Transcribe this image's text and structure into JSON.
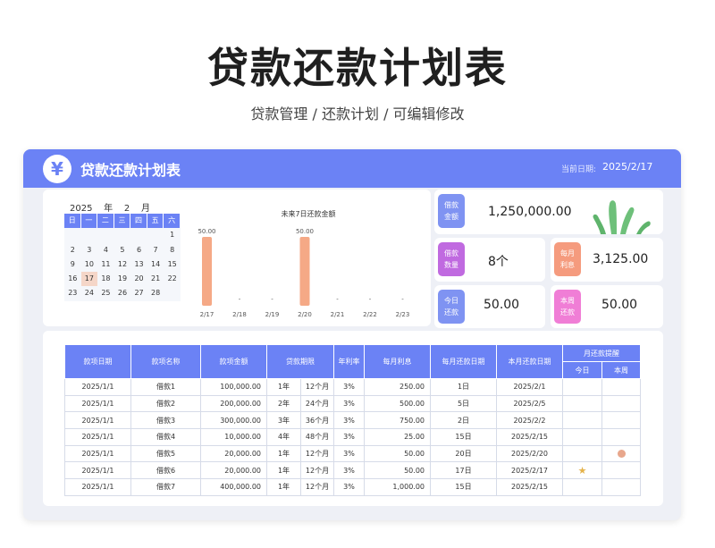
{
  "page": {
    "title": "贷款还款计划表",
    "subtitle": "贷款管理 /  还款计划 /  可编辑修改"
  },
  "header": {
    "app_title": "贷款还款计划表",
    "logo_glyph": "¥",
    "date_label": "当前日期:",
    "date_value": "2025/2/17"
  },
  "calendar": {
    "year": "2025",
    "year_unit": "年",
    "month": "2",
    "month_unit": "月",
    "weekdays": [
      "日",
      "一",
      "二",
      "三",
      "四",
      "五",
      "六"
    ],
    "rows": [
      [
        "",
        "",
        "",
        "",
        "",
        "",
        "1"
      ],
      [
        "2",
        "3",
        "4",
        "5",
        "6",
        "7",
        "8"
      ],
      [
        "9",
        "10",
        "11",
        "12",
        "13",
        "14",
        "15"
      ],
      [
        "16",
        "17",
        "18",
        "19",
        "20",
        "21",
        "22"
      ],
      [
        "23",
        "24",
        "25",
        "26",
        "27",
        "28",
        ""
      ]
    ],
    "today": "17"
  },
  "chart_data": {
    "type": "bar",
    "title": "未来7日还款金额",
    "categories": [
      "2/17",
      "2/18",
      "2/19",
      "2/20",
      "2/21",
      "2/22",
      "2/23"
    ],
    "values": [
      50,
      0,
      0,
      50,
      0,
      0,
      0
    ],
    "labels": [
      "50.00",
      "-",
      "-",
      "50.00",
      "-",
      "-",
      "-"
    ],
    "ylim": [
      0,
      50
    ],
    "bar_color": "#f5a986"
  },
  "stats": {
    "loan_amount": {
      "label_1": "借款",
      "label_2": "金额",
      "value": "1,250,000.00",
      "color": "#7f93f2"
    },
    "loan_count": {
      "label_1": "借款",
      "label_2": "数量",
      "value": "8个",
      "color": "#c06ae0"
    },
    "monthly_interest": {
      "label_1": "每月",
      "label_2": "利息",
      "value": "3,125.00",
      "color": "#f59b7e"
    },
    "today_repay": {
      "label_1": "今日",
      "label_2": "还款",
      "value": "50.00",
      "color": "#7f93f2"
    },
    "week_repay": {
      "label_1": "本周",
      "label_2": "还款",
      "value": "50.00",
      "color": "#f07ed6"
    }
  },
  "table": {
    "headers": [
      "款项日期",
      "款项名称",
      "款项金额",
      "贷款期限",
      "年利率",
      "每月利息",
      "每月还款日期",
      "本月还款日期"
    ],
    "reminder_header": "月还款提醒",
    "reminder_sub": [
      "今日",
      "本周"
    ],
    "rows": [
      {
        "date": "2025/1/1",
        "name": "借款1",
        "amount": "100,000.00",
        "term_years": "1年",
        "term_months": "12个月",
        "rate": "3%",
        "interest": "250.00",
        "pay_day": "1日",
        "this_month": "2025/2/1",
        "today": "",
        "week": ""
      },
      {
        "date": "2025/1/1",
        "name": "借款2",
        "amount": "200,000.00",
        "term_years": "2年",
        "term_months": "24个月",
        "rate": "3%",
        "interest": "500.00",
        "pay_day": "5日",
        "this_month": "2025/2/5",
        "today": "",
        "week": ""
      },
      {
        "date": "2025/1/1",
        "name": "借款3",
        "amount": "300,000.00",
        "term_years": "3年",
        "term_months": "36个月",
        "rate": "3%",
        "interest": "750.00",
        "pay_day": "2日",
        "this_month": "2025/2/2",
        "today": "",
        "week": ""
      },
      {
        "date": "2025/1/1",
        "name": "借款4",
        "amount": "10,000.00",
        "term_years": "4年",
        "term_months": "48个月",
        "rate": "3%",
        "interest": "25.00",
        "pay_day": "15日",
        "this_month": "2025/2/15",
        "today": "",
        "week": ""
      },
      {
        "date": "2025/1/1",
        "name": "借款5",
        "amount": "20,000.00",
        "term_years": "1年",
        "term_months": "12个月",
        "rate": "3%",
        "interest": "50.00",
        "pay_day": "20日",
        "this_month": "2025/2/20",
        "today": "",
        "week": "dot"
      },
      {
        "date": "2025/1/1",
        "name": "借款6",
        "amount": "20,000.00",
        "term_years": "1年",
        "term_months": "12个月",
        "rate": "3%",
        "interest": "50.00",
        "pay_day": "17日",
        "this_month": "2025/2/17",
        "today": "star",
        "week": ""
      },
      {
        "date": "2025/1/1",
        "name": "借款7",
        "amount": "400,000.00",
        "term_years": "1年",
        "term_months": "12个月",
        "rate": "3%",
        "interest": "1,000.00",
        "pay_day": "15日",
        "this_month": "2025/2/15",
        "today": "",
        "week": ""
      }
    ]
  }
}
